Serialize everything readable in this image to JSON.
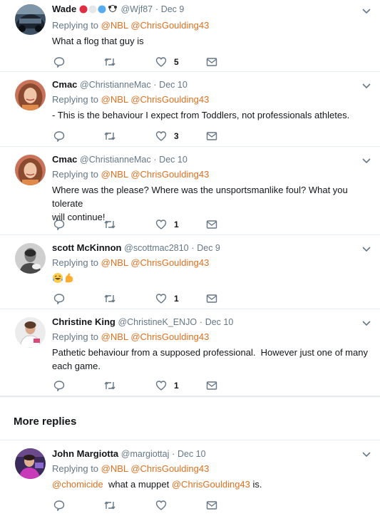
{
  "tweets": [
    {
      "name": "Wade",
      "handle": "@Wjf87",
      "sep": "·",
      "date": "Dec 9",
      "replying_prefix": "Replying to",
      "mention1": "@NBL",
      "mention2": "@ChrisGoulding43",
      "text": "What a flog that guy is",
      "likes": "5"
    },
    {
      "name": "Cmac",
      "handle": "@ChristianneMac",
      "sep": "·",
      "date": "Dec 10",
      "replying_prefix": "Replying to",
      "mention1": "@NBL",
      "mention2": "@ChrisGoulding43",
      "text": "- This is the behaviour I expect from Toddlers, not professionals athletes.",
      "likes": "3"
    },
    {
      "name": "Cmac",
      "handle": "@ChristianneMac",
      "sep": "·",
      "date": "Dec 10",
      "replying_prefix": "Replying to",
      "mention1": "@NBL",
      "mention2": "@ChrisGoulding43",
      "text_line1": "Where was the please? Where was the unsportsmanlike foul? What you tolerate",
      "text_line2": "will continue!",
      "likes": "1"
    },
    {
      "name": "scott McKinnon",
      "handle": "@scottmac2810",
      "sep": "·",
      "date": "Dec 9",
      "replying_prefix": "Replying to",
      "mention1": "@NBL",
      "mention2": "@ChrisGoulding43",
      "likes": "1"
    },
    {
      "name": "Christine King",
      "handle": "@ChristineK_ENJO",
      "sep": "·",
      "date": "Dec 10",
      "replying_prefix": "Replying to",
      "mention1": "@NBL",
      "mention2": "@ChrisGoulding43",
      "text_line1": "Pathetic behaviour from a supposed professional.  However just one of many",
      "text_line2": "each game.",
      "likes": "1"
    },
    {
      "name": "John Margiotta",
      "handle": "@margiottaj",
      "sep": "·",
      "date": "Dec 10",
      "replying_prefix": "Replying to",
      "mention1": "@NBL",
      "mention2": "@ChrisGoulding43",
      "text_mention1": "@chomicide",
      "text_middle": "  what a muppet ",
      "text_mention2": "@ChrisGoulding43",
      "text_end": " is."
    }
  ],
  "more_replies_label": "More replies",
  "colors": {
    "accent": "#e0701f",
    "secondary_text": "#657786",
    "divider": "#e6ecf0"
  },
  "icons": [
    "reply-icon",
    "retweet-icon",
    "like-icon",
    "message-icon",
    "chevron-down-icon"
  ]
}
